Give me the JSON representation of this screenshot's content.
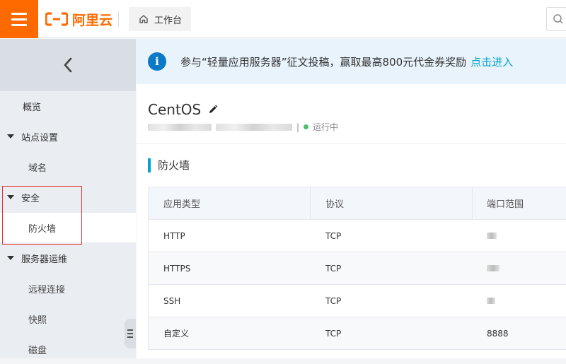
{
  "topbar": {
    "brand": "阿里云",
    "workbench_label": "工作台"
  },
  "sidebar": {
    "items": [
      {
        "label": "概览"
      },
      {
        "label": "站点设置"
      },
      {
        "label": "域名"
      },
      {
        "label": "安全"
      },
      {
        "label": "防火墙"
      },
      {
        "label": "服务器运维"
      },
      {
        "label": "远程连接"
      },
      {
        "label": "快照"
      },
      {
        "label": "磁盘"
      }
    ]
  },
  "banner": {
    "text": "参与“轻量应用服务器”征文投稿，赢取最高800元代金券奖励",
    "link": "点击进入"
  },
  "instance": {
    "title": "CentOS",
    "separator": "|",
    "status": "运行中"
  },
  "section": {
    "title": "防火墙"
  },
  "table": {
    "headers": [
      "应用类型",
      "协议",
      "端口范围"
    ],
    "rows": [
      {
        "app": "HTTP",
        "protocol": "TCP",
        "port": ""
      },
      {
        "app": "HTTPS",
        "protocol": "TCP",
        "port": ""
      },
      {
        "app": "SSH",
        "protocol": "TCP",
        "port": ""
      },
      {
        "app": "自定义",
        "protocol": "TCP",
        "port": "8888"
      }
    ]
  },
  "colors": {
    "brand": "#ff6a00",
    "link": "#00a2ca",
    "status_running": "#4cbf6e",
    "highlight_box": "#e5312e"
  },
  "icons": {
    "menu": "hamburger-icon",
    "home": "home-icon",
    "search": "search-icon",
    "back": "chevron-left-icon",
    "info": "info-icon",
    "edit": "pencil-icon"
  }
}
